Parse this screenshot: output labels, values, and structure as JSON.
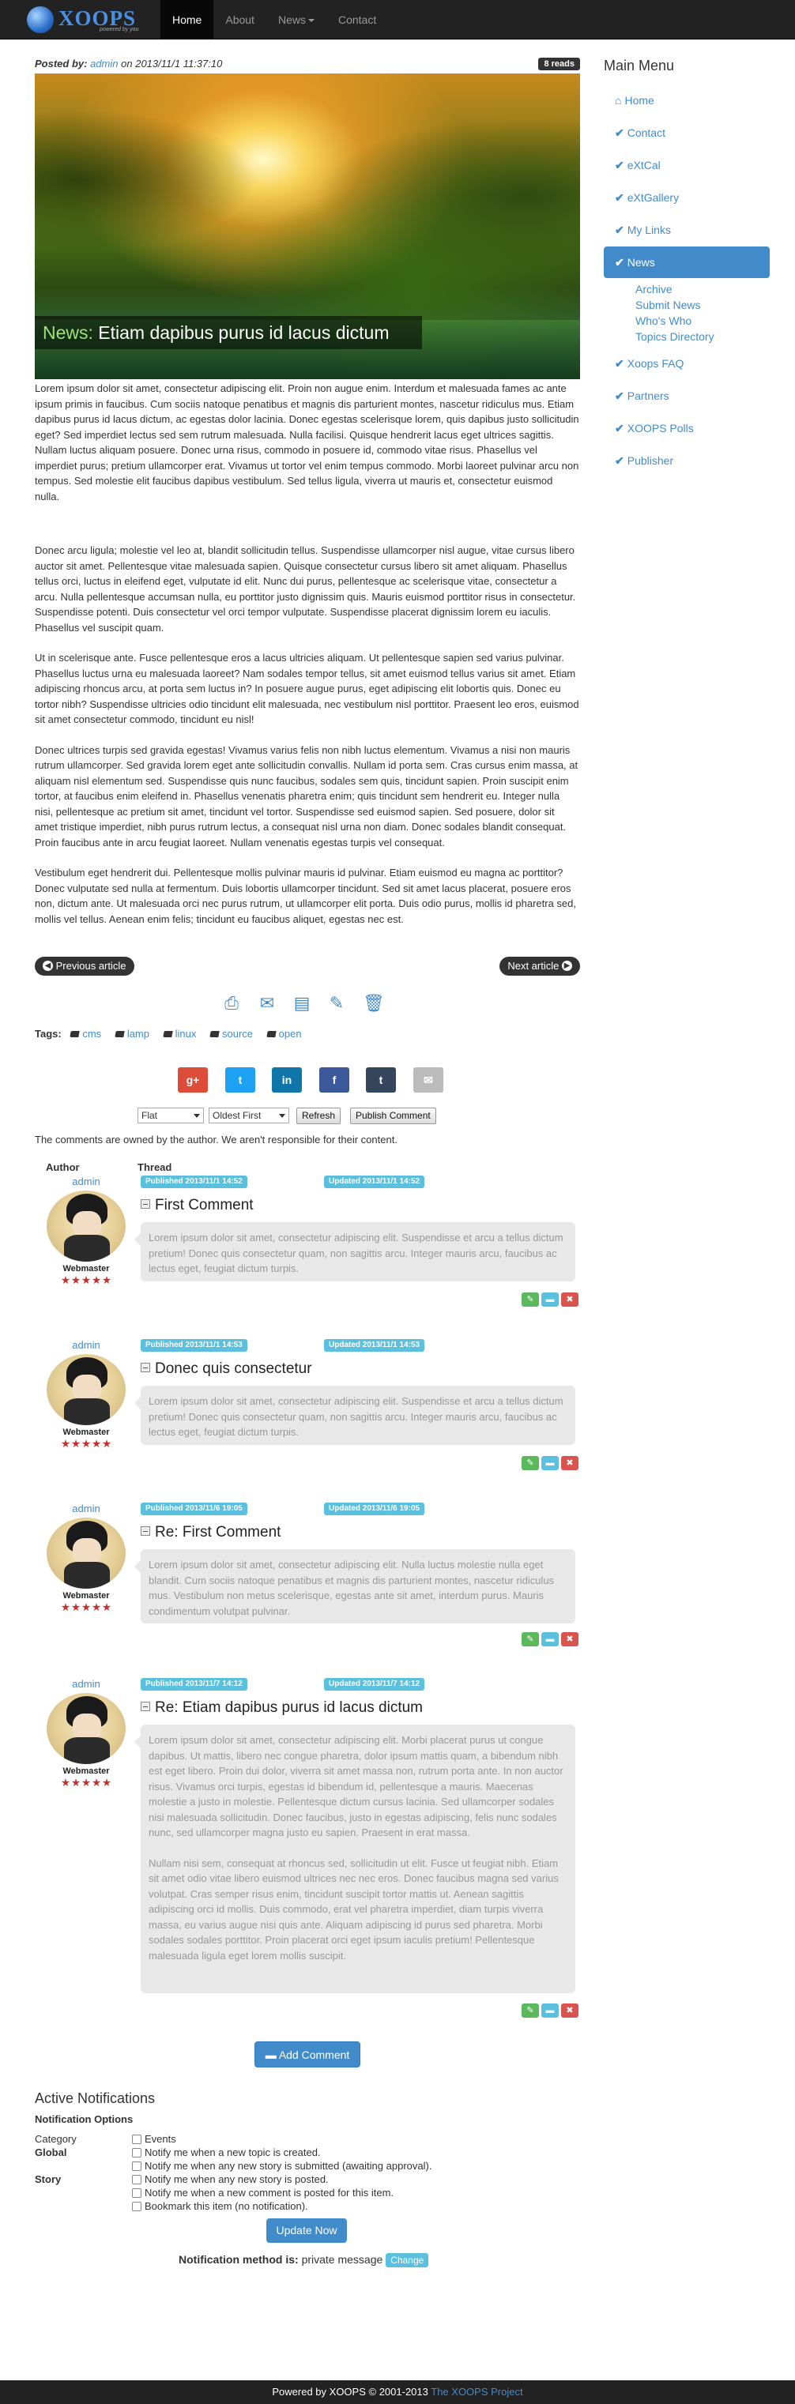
{
  "nav": {
    "brand": "XOOPS",
    "brand_sub": "powered by you",
    "items": [
      "Home",
      "About",
      "News",
      "Contact"
    ]
  },
  "article": {
    "posted_by_label": "Posted by:",
    "author": "admin",
    "date_text": "on 2013/11/1 11:37:10",
    "reads": "8 reads",
    "caption_cat": "News:",
    "caption_title": "Etiam dapibus purus id lacus dictum",
    "paragraphs": [
      "Lorem ipsum dolor sit amet, consectetur adipiscing elit. Proin non augue enim. Interdum et malesuada fames ac ante ipsum primis in faucibus. Cum sociis natoque penatibus et magnis dis parturient montes, nascetur ridiculus mus. Etiam dapibus purus id lacus dictum, ac egestas dolor lacinia. Donec egestas scelerisque lorem, quis dapibus justo sollicitudin eget? Sed imperdiet lectus sed sem rutrum malesuada. Nulla facilisi. Quisque hendrerit lacus eget ultrices sagittis. Nullam luctus aliquam posuere. Donec urna risus, commodo in posuere id, commodo vitae risus. Phasellus vel imperdiet purus; pretium ullamcorper erat. Vivamus ut tortor vel enim tempus commodo. Morbi laoreet pulvinar arcu non tempus. Sed molestie elit faucibus dapibus vestibulum. Sed tellus ligula, viverra ut mauris et, consectetur euismod nulla.",
      "Donec arcu ligula; molestie vel leo at, blandit sollicitudin tellus. Suspendisse ullamcorper nisl augue, vitae cursus libero auctor sit amet. Pellentesque vitae malesuada sapien. Quisque consectetur cursus libero sit amet aliquam. Phasellus tellus orci, luctus in eleifend eget, vulputate id elit. Nunc dui purus, pellentesque ac scelerisque vitae, consectetur a arcu. Nulla pellentesque accumsan nulla, eu porttitor justo dignissim quis. Mauris euismod porttitor risus in consectetur. Suspendisse potenti. Duis consectetur vel orci tempor vulputate. Suspendisse placerat dignissim lorem eu iaculis. Phasellus vel suscipit quam.",
      "Ut in scelerisque ante. Fusce pellentesque eros a lacus ultricies aliquam. Ut pellentesque sapien sed varius pulvinar. Phasellus luctus urna eu malesuada laoreet? Nam sodales tempor tellus, sit amet euismod tellus varius sit amet. Etiam adipiscing rhoncus arcu, at porta sem luctus in? In posuere augue purus, eget adipiscing elit lobortis quis. Donec eu tortor nibh? Suspendisse ultricies odio tincidunt elit malesuada, nec vestibulum nisl porttitor. Praesent leo eros, euismod sit amet consectetur commodo, tincidunt eu nisl!",
      "Donec ultrices turpis sed gravida egestas! Vivamus varius felis non nibh luctus elementum. Vivamus a nisi non mauris rutrum ullamcorper. Sed gravida lorem eget ante sollicitudin convallis. Nullam id porta sem. Cras cursus enim massa, at aliquam nisl elementum sed. Suspendisse quis nunc faucibus, sodales sem quis, tincidunt sapien. Proin suscipit enim tortor, at faucibus enim eleifend in. Phasellus venenatis pharetra enim; quis tincidunt sem hendrerit eu. Integer nulla nisi, pellentesque ac pretium sit amet, tincidunt vel tortor. Suspendisse sed euismod sapien. Sed posuere, dolor sit amet tristique imperdiet, nibh purus rutrum lectus, a consequat nisl urna non diam. Donec sodales blandit consequat. Proin faucibus ante in arcu feugiat laoreet. Nullam venenatis egestas turpis vel consequat.",
      "Vestibulum eget hendrerit dui. Pellentesque mollis pulvinar mauris id pulvinar. Etiam euismod eu magna ac porttitor? Donec vulputate sed nulla at fermentum. Duis lobortis ullamcorper tincidunt. Sed sit amet lacus placerat, posuere eros non, dictum ante. Ut malesuada orci nec purus rutrum, ut ullamcorper elit porta. Duis odio purus, mollis id pharetra sed, mollis vel tellus. Aenean enim felis; tincidunt eu faucibus aliquet, egestas nec est."
    ],
    "prev": "Previous article",
    "next": "Next article",
    "tags_label": "Tags:",
    "tags": [
      "cms",
      "lamp",
      "linux",
      "source",
      "open"
    ]
  },
  "social": [
    "g+",
    "t",
    "in",
    "f",
    "t",
    "✉"
  ],
  "controls": {
    "mode": "Flat",
    "order": "Oldest First",
    "refresh": "Refresh",
    "publish": "Publish Comment",
    "owned_text": "The comments are owned by the author. We aren't responsible for their content.",
    "author_col": "Author",
    "thread_col": "Thread"
  },
  "comments": [
    {
      "user": "admin",
      "rank": "Webmaster",
      "published": "Published 2013/11/1 14:52",
      "updated": "Updated 2013/11/1 14:52",
      "title": "First Comment",
      "text": [
        "Lorem ipsum dolor sit amet, consectetur adipiscing elit. Suspendisse et arcu a tellus dictum pretium! Donec quis consectetur quam, non sagittis arcu. Integer mauris arcu, faucibus ac lectus eget, feugiat dictum turpis."
      ]
    },
    {
      "user": "admin",
      "rank": "Webmaster",
      "published": "Published 2013/11/1 14:53",
      "updated": "Updated 2013/11/1 14:53",
      "title": "Donec quis consectetur",
      "text": [
        "Lorem ipsum dolor sit amet, consectetur adipiscing elit. Suspendisse et arcu a tellus dictum pretium! Donec quis consectetur quam, non sagittis arcu. Integer mauris arcu, faucibus ac lectus eget, feugiat dictum turpis."
      ]
    },
    {
      "user": "admin",
      "rank": "Webmaster",
      "published": "Published 2013/11/6 19:05",
      "updated": "Updated 2013/11/6 19:05",
      "title": "Re: First Comment",
      "text": [
        "Lorem ipsum dolor sit amet, consectetur adipiscing elit. Nulla luctus molestie nulla eget blandit. Cum sociis natoque penatibus et magnis dis parturient montes, nascetur ridiculus mus. Vestibulum non metus scelerisque, egestas ante sit amet, interdum purus. Mauris condimentum volutpat pulvinar."
      ]
    },
    {
      "user": "admin",
      "rank": "Webmaster",
      "published": "Published 2013/11/7 14:12",
      "updated": "Updated 2013/11/7 14:12",
      "title": "Re: Etiam dapibus purus id lacus dictum",
      "text": [
        "Lorem ipsum dolor sit amet, consectetur adipiscing elit. Morbi placerat purus ut congue dapibus. Ut mattis, libero nec congue pharetra, dolor ipsum mattis quam, a bibendum nibh est eget libero. Proin dui dolor, viverra sit amet massa non, rutrum porta ante. In non auctor risus. Vivamus orci turpis, egestas id bibendum id, pellentesque a mauris. Maecenas molestie a justo in molestie. Pellentesque dictum cursus lacinia. Sed ullamcorper sodales nisi malesuada sollicitudin. Donec faucibus, justo in egestas adipiscing, felis nunc sodales nunc, sed ullamcorper magna justo eu sapien. Praesent in erat massa.",
        "Nullam nisi sem, consequat at rhoncus sed, sollicitudin ut elit. Fusce ut feugiat nibh. Etiam sit amet odio vitae libero euismod ultrices nec nec eros. Donec faucibus magna sed varius volutpat. Cras semper risus enim, tincidunt suscipit tortor mattis ut. Aenean sagittis adipiscing orci id mollis. Duis commodo, erat vel pharetra imperdiet, diam turpis viverra massa, eu varius augue nisi quis ante. Aliquam adipiscing id purus sed pharetra. Morbi sodales sodales porttitor. Proin placerat orci eget ipsum iaculis pretium! Pellentesque malesuada ligula eget lorem mollis suscipit."
      ]
    }
  ],
  "add_comment": "Add Comment",
  "notifications": {
    "heading": "Active Notifications",
    "options_label": "Notification Options",
    "rows": [
      {
        "label": "Category",
        "text": "Events"
      },
      {
        "label": "Global",
        "text": "Notify me when a new topic is created."
      },
      {
        "label": "",
        "text": "Notify me when any new story is submitted (awaiting approval)."
      },
      {
        "label": "Story",
        "text": "Notify me when any new story is posted."
      },
      {
        "label": "",
        "text": "Notify me when a new comment is posted for this item."
      },
      {
        "label": "",
        "text": "Bookmark this item (no notification)."
      }
    ],
    "update": "Update Now",
    "method_label": "Notification method is:",
    "method_value": "private message",
    "change": "Change"
  },
  "sidebar": {
    "title": "Main Menu",
    "items": [
      "Home",
      "Contact",
      "eXtCal",
      "eXtGallery",
      "My Links",
      "News",
      "Xoops FAQ",
      "Partners",
      "XOOPS Polls",
      "Publisher"
    ],
    "news_sub": [
      "Archive",
      "Submit News",
      "Who's Who",
      "Topics Directory"
    ]
  },
  "footer": {
    "text": "Powered by XOOPS © 2001-2013",
    "link": "The XOOPS Project"
  },
  "colors": {
    "accent": "#428bca",
    "label": "#5bc0de",
    "navbar": "#222222"
  }
}
